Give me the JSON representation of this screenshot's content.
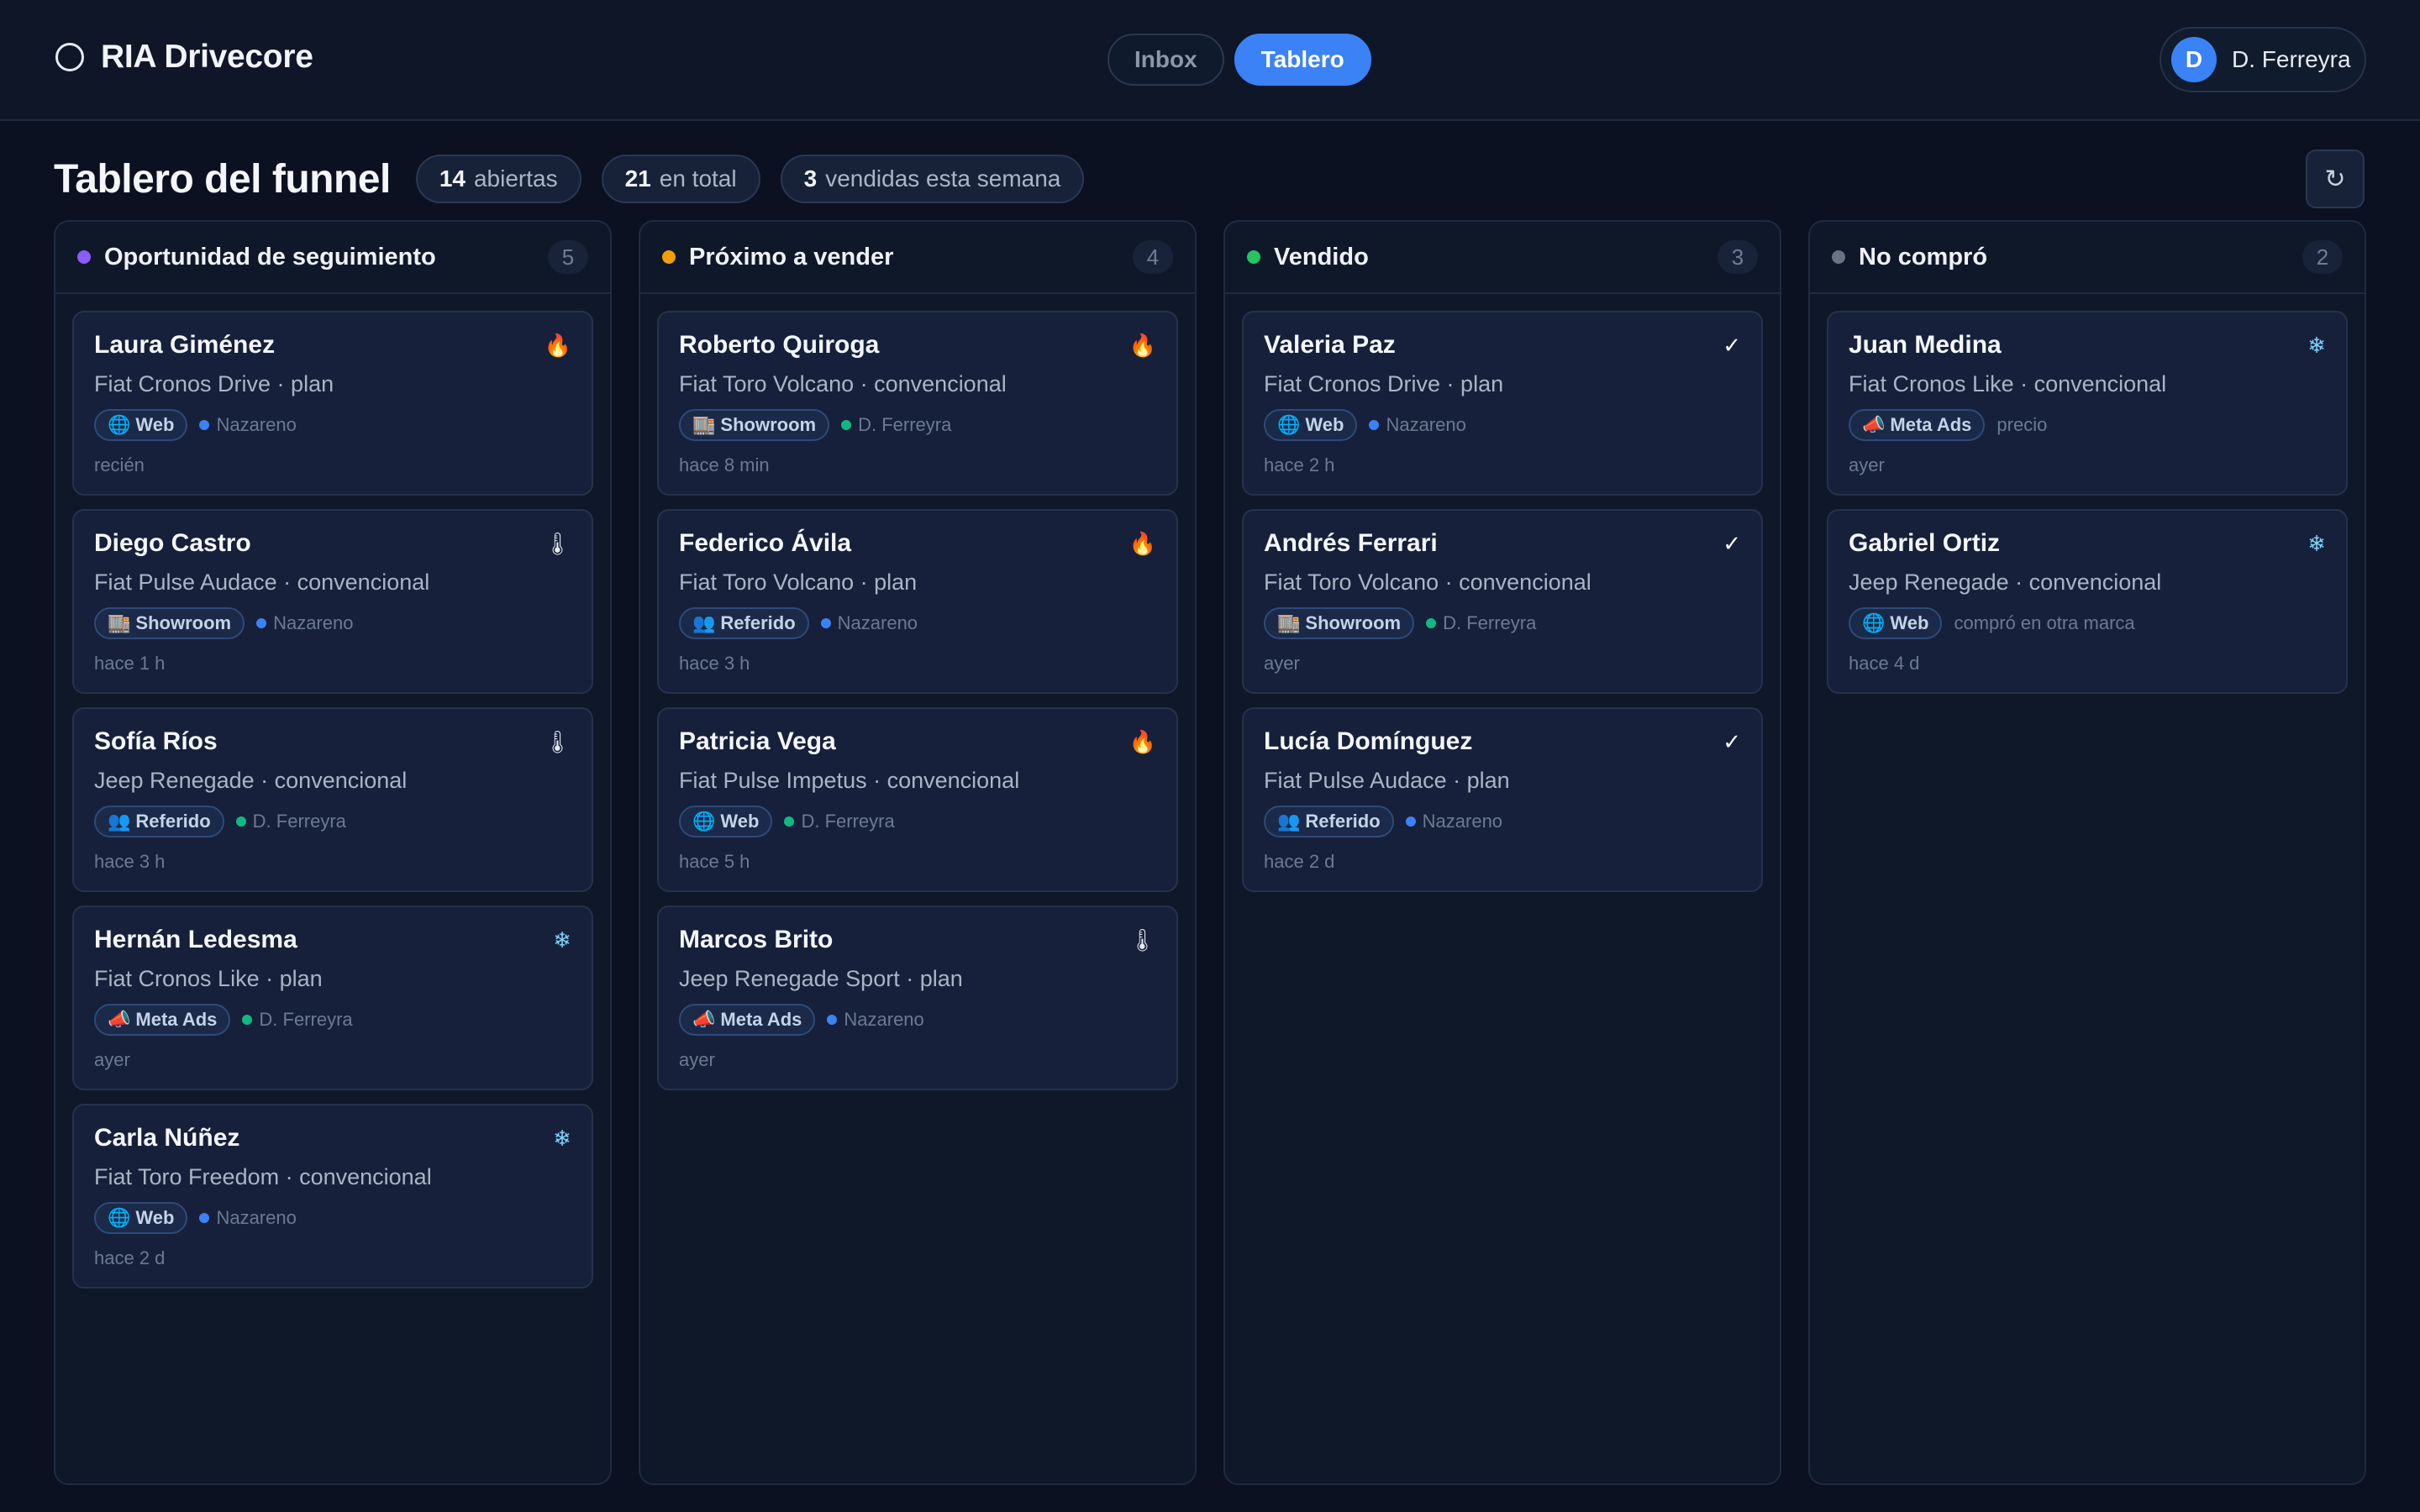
{
  "app": {
    "name": "RIA Drivecore"
  },
  "nav": {
    "tabs": [
      {
        "label": "Inbox",
        "active": false
      },
      {
        "label": "Tablero",
        "active": true
      }
    ]
  },
  "user": {
    "initial": "D",
    "name": "D. Ferreyra"
  },
  "page": {
    "title": "Tablero del funnel",
    "stats": [
      {
        "value": "14",
        "label": "abiertas"
      },
      {
        "value": "21",
        "label": "en total"
      },
      {
        "value": "3",
        "label": "vendidas esta semana"
      }
    ],
    "refresh_icon": "↻"
  },
  "colors": {
    "accent": "#3b82f6",
    "nazareno": "#3b82f6",
    "ferreyra": "#10b981"
  },
  "columns": [
    {
      "title": "Oportunidad de seguimiento",
      "count": "5",
      "dot": "#8b5cf6",
      "cards": [
        {
          "name": "Laura Giménez",
          "model": "Fiat Cronos Drive · plan",
          "source_icon": "🌐",
          "source": "Web",
          "assignee": "Nazareno",
          "assignee_color": "#3b82f6",
          "time": "recién",
          "temp_icon": "🔥",
          "temp_name": "fire-icon"
        },
        {
          "name": "Diego Castro",
          "model": "Fiat Pulse Audace · convencional",
          "source_icon": "🏬",
          "source": "Showroom",
          "assignee": "Nazareno",
          "assignee_color": "#3b82f6",
          "time": "hace 1 h",
          "temp_icon": "🌡",
          "temp_name": "thermometer-icon"
        },
        {
          "name": "Sofía Ríos",
          "model": "Jeep Renegade · convencional",
          "source_icon": "👥",
          "source": "Referido",
          "assignee": "D. Ferreyra",
          "assignee_color": "#10b981",
          "time": "hace 3 h",
          "temp_icon": "🌡",
          "temp_name": "thermometer-icon"
        },
        {
          "name": "Hernán Ledesma",
          "model": "Fiat Cronos Like · plan",
          "source_icon": "📣",
          "source": "Meta Ads",
          "assignee": "D. Ferreyra",
          "assignee_color": "#10b981",
          "time": "ayer",
          "temp_icon": "❄",
          "temp_name": "snowflake-icon"
        },
        {
          "name": "Carla Núñez",
          "model": "Fiat Toro Freedom · convencional",
          "source_icon": "🌐",
          "source": "Web",
          "assignee": "Nazareno",
          "assignee_color": "#3b82f6",
          "time": "hace 2 d",
          "temp_icon": "❄",
          "temp_name": "snowflake-icon"
        }
      ]
    },
    {
      "title": "Próximo a vender",
      "count": "4",
      "dot": "#f59e0b",
      "cards": [
        {
          "name": "Roberto Quiroga",
          "model": "Fiat Toro Volcano · convencional",
          "source_icon": "🏬",
          "source": "Showroom",
          "assignee": "D. Ferreyra",
          "assignee_color": "#10b981",
          "time": "hace 8 min",
          "temp_icon": "🔥",
          "temp_name": "fire-icon"
        },
        {
          "name": "Federico Ávila",
          "model": "Fiat Toro Volcano · plan",
          "source_icon": "👥",
          "source": "Referido",
          "assignee": "Nazareno",
          "assignee_color": "#3b82f6",
          "time": "hace 3 h",
          "temp_icon": "🔥",
          "temp_name": "fire-icon"
        },
        {
          "name": "Patricia Vega",
          "model": "Fiat Pulse Impetus · convencional",
          "source_icon": "🌐",
          "source": "Web",
          "assignee": "D. Ferreyra",
          "assignee_color": "#10b981",
          "time": "hace 5 h",
          "temp_icon": "🔥",
          "temp_name": "fire-icon"
        },
        {
          "name": "Marcos Brito",
          "model": "Jeep Renegade Sport · plan",
          "source_icon": "📣",
          "source": "Meta Ads",
          "assignee": "Nazareno",
          "assignee_color": "#3b82f6",
          "time": "ayer",
          "temp_icon": "🌡",
          "temp_name": "thermometer-icon"
        }
      ]
    },
    {
      "title": "Vendido",
      "count": "3",
      "dot": "#22c55e",
      "cards": [
        {
          "name": "Valeria Paz",
          "model": "Fiat Cronos Drive · plan",
          "source_icon": "🌐",
          "source": "Web",
          "assignee": "Nazareno",
          "assignee_color": "#3b82f6",
          "time": "hace 2 h",
          "temp_icon": "✓",
          "temp_name": "check-icon"
        },
        {
          "name": "Andrés Ferrari",
          "model": "Fiat Toro Volcano · convencional",
          "source_icon": "🏬",
          "source": "Showroom",
          "assignee": "D. Ferreyra",
          "assignee_color": "#10b981",
          "time": "ayer",
          "temp_icon": "✓",
          "temp_name": "check-icon"
        },
        {
          "name": "Lucía Domínguez",
          "model": "Fiat Pulse Audace · plan",
          "source_icon": "👥",
          "source": "Referido",
          "assignee": "Nazareno",
          "assignee_color": "#3b82f6",
          "time": "hace 2 d",
          "temp_icon": "✓",
          "temp_name": "check-icon"
        }
      ]
    },
    {
      "title": "No compró",
      "count": "2",
      "dot": "#6b7280",
      "cards": [
        {
          "name": "Juan Medina",
          "model": "Fiat Cronos Like · convencional",
          "source_icon": "📣",
          "source": "Meta Ads",
          "assignee": "precio",
          "assignee_color": "",
          "time": "ayer",
          "temp_icon": "❄",
          "temp_name": "snowflake-icon"
        },
        {
          "name": "Gabriel Ortiz",
          "model": "Jeep Renegade · convencional",
          "source_icon": "🌐",
          "source": "Web",
          "assignee": "compró en otra marca",
          "assignee_color": "",
          "time": "hace 4 d",
          "temp_icon": "❄",
          "temp_name": "snowflake-icon"
        }
      ]
    }
  ]
}
